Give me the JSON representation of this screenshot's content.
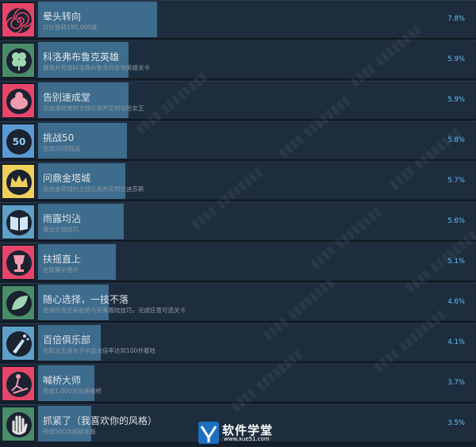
{
  "achievements": [
    {
      "title": "晕头转向",
      "desc": "共计旋转180,000度",
      "percent": "7.8%",
      "fill": 0.078,
      "icon": "spiral-icon",
      "color": "#e8456b"
    },
    {
      "title": "科洛弗布鲁克英雄",
      "desc": "解锁并完成科洛弗布鲁克的本地英雄关卡",
      "percent": "5.9%",
      "fill": 0.059,
      "icon": "clover-icon",
      "color": "#4a8c6a"
    },
    {
      "title": "告别速成堂",
      "desc": "完成速成堂的主线任务并见到冒险女王",
      "percent": "5.9%",
      "fill": 0.059,
      "icon": "pig-icon",
      "color": "#e8456b"
    },
    {
      "title": "挑战50",
      "desc": "完成50项挑战",
      "percent": "5.8%",
      "fill": 0.058,
      "icon": "badge-50-icon",
      "color": "#5b9bd5"
    },
    {
      "title": "问鼎金塔城",
      "desc": "完成金塔城的主线任务并见到拉迪苏斯",
      "percent": "5.7%",
      "fill": 0.057,
      "icon": "crown-icon",
      "color": "#f0d05a"
    },
    {
      "title": "雨露均沾",
      "desc": "做出全部技巧",
      "percent": "5.6%",
      "fill": 0.056,
      "icon": "book-icon",
      "color": "#5fa0c8"
    },
    {
      "title": "扶摇直上",
      "desc": "在联赛中晋升",
      "percent": "5.1%",
      "fill": 0.051,
      "icon": "trophy-icon",
      "color": "#e8456b"
    },
    {
      "title": "随心选择，一技不落",
      "desc": "使用所有完美舷桥与完美着陆技巧，完成任意可选关卡",
      "percent": "4.6%",
      "fill": 0.046,
      "icon": "leaf-icon",
      "color": "#4a8c6a"
    },
    {
      "title": "百倍俱乐部",
      "desc": "在职业生涯关卡中连击倍率达到100并着陆",
      "percent": "4.1%",
      "fill": 0.041,
      "icon": "bottle-icon",
      "color": "#5fa0c8"
    },
    {
      "title": "喊桥大师",
      "desc": "完成1,000次完美喊桥",
      "percent": "3.7%",
      "fill": 0.037,
      "icon": "skater-icon",
      "color": "#e8456b"
    },
    {
      "title": "抓紧了（我喜欢你的风格）",
      "desc": "完成500次超级抓板",
      "percent": "3.5%",
      "fill": 0.035,
      "icon": "hand-icon",
      "color": "#4a8c6a"
    }
  ],
  "branding": {
    "name": "软件学堂",
    "url": "www.xue51.com"
  }
}
